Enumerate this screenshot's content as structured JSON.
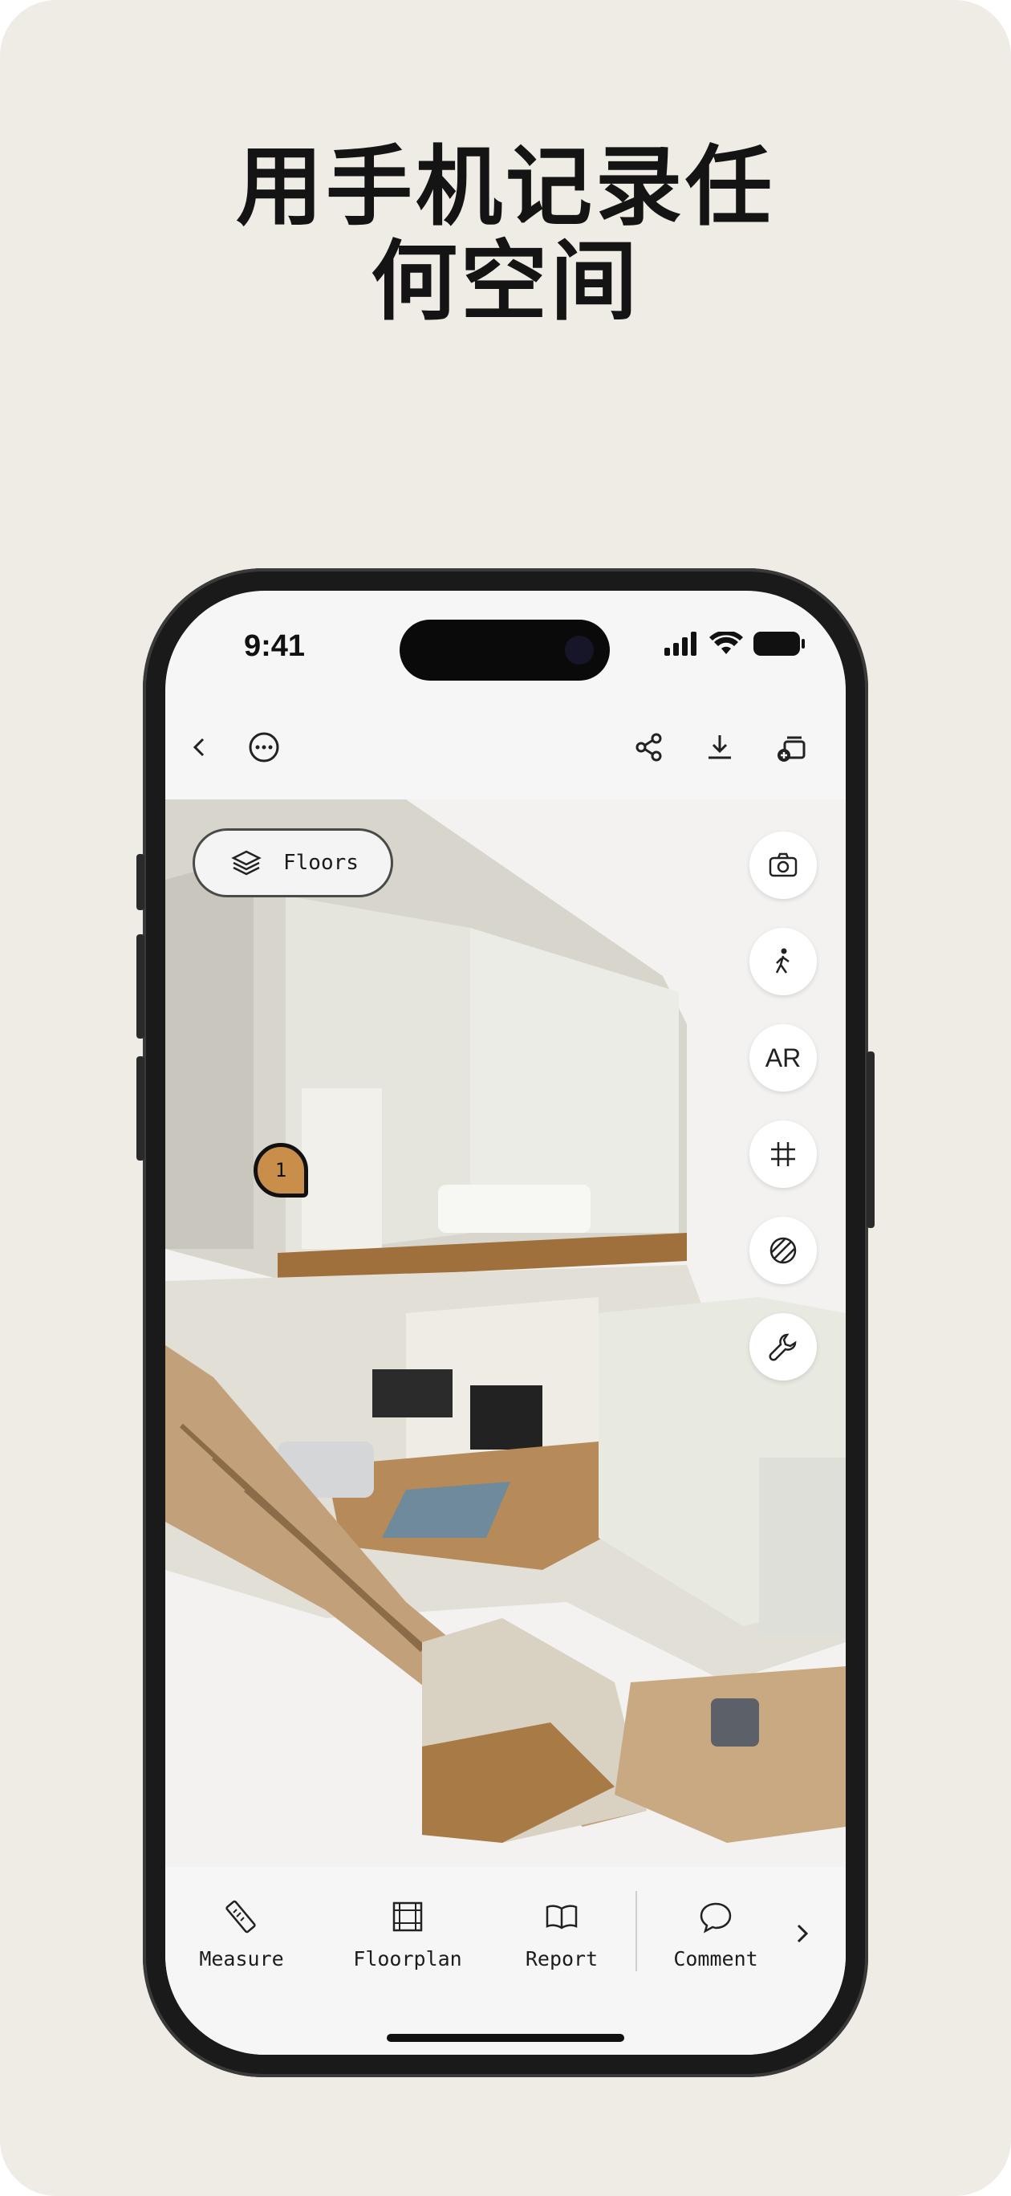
{
  "headline": {
    "line1": "用手机记录任",
    "line2": "何空间"
  },
  "status": {
    "time": "9:41"
  },
  "topbar": {
    "icons": [
      "back-chevron-icon",
      "more-icon",
      "share-icon",
      "download-icon",
      "add-to-collection-icon"
    ]
  },
  "viewer": {
    "floors_label": "Floors",
    "pin_label": "1",
    "tools": [
      "camera-icon",
      "walk-icon",
      "AR",
      "grid-icon",
      "texture-icon",
      "wrench-icon"
    ],
    "ar_label": "AR"
  },
  "bottombar": {
    "items": [
      {
        "label": "Measure",
        "icon": "ruler-icon"
      },
      {
        "label": "Floorplan",
        "icon": "floorplan-icon"
      },
      {
        "label": "Report",
        "icon": "book-icon"
      },
      {
        "label": "Comment",
        "icon": "comment-icon"
      }
    ],
    "more_icon": "chevron-right-icon"
  },
  "colors": {
    "background": "#efebe5",
    "pin": "#c98f4a",
    "phone": "#1a1a1a"
  }
}
